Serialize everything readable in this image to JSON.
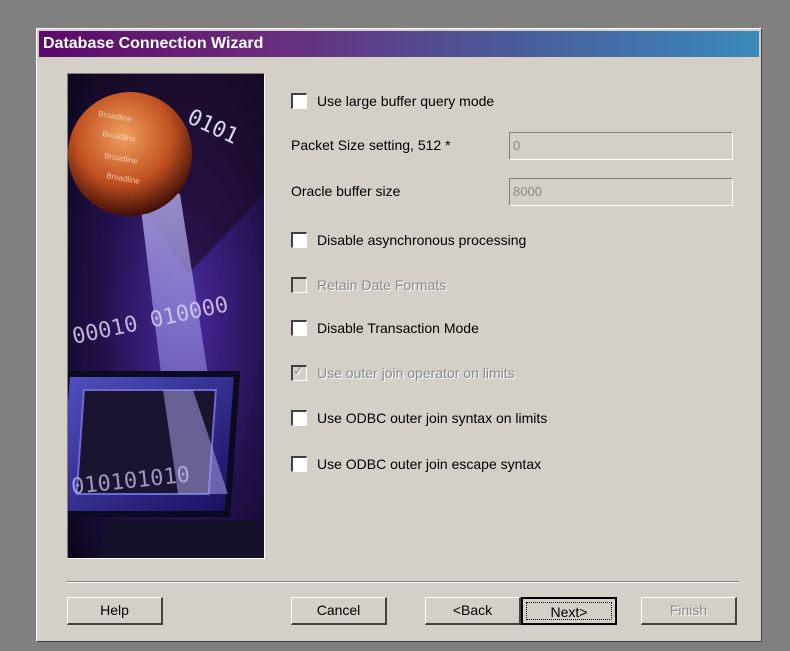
{
  "window": {
    "title": "Database Connection Wizard"
  },
  "options": {
    "large_buffer": {
      "label": "Use large buffer query mode",
      "checked": false,
      "enabled": true
    },
    "disable_async": {
      "label": "Disable asynchronous processing",
      "checked": false,
      "enabled": true
    },
    "retain_date": {
      "label": "Retain Date Formats",
      "checked": false,
      "enabled": false
    },
    "disable_txn": {
      "label": "Disable Transaction Mode",
      "checked": false,
      "enabled": true
    },
    "outer_join_op": {
      "label": "Use outer join operator on limits",
      "checked": true,
      "enabled": false
    },
    "odbc_outer_join": {
      "label": "Use ODBC outer join syntax on limits",
      "checked": false,
      "enabled": true
    },
    "odbc_escape": {
      "label": "Use ODBC outer join escape syntax",
      "checked": false,
      "enabled": true
    }
  },
  "fields": {
    "packet_size": {
      "label": "Packet Size setting, 512 *",
      "value": "0"
    },
    "oracle_buffer": {
      "label": "Oracle buffer size",
      "value": "8000"
    }
  },
  "buttons": {
    "help": "Help",
    "cancel": "Cancel",
    "back": "<Back",
    "next": "Next>",
    "finish": "Finish"
  },
  "side_image": {
    "binary_text_top": "0101",
    "binary_text_mid": "00010 010000",
    "binary_text_bottom": "010101010"
  },
  "colors": {
    "dialog_bg": "#d4d0c8",
    "title_start": "#5a0a68",
    "title_end": "#3a8ab8",
    "disabled_text": "#8a8a8a"
  }
}
